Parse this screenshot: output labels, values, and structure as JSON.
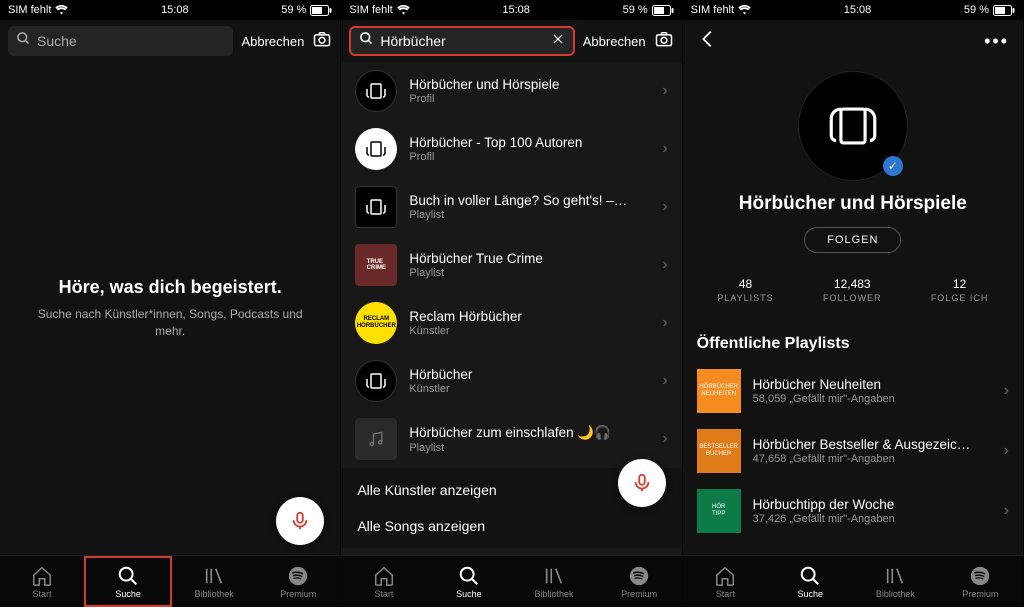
{
  "status": {
    "carrier": "SIM fehlt",
    "time": "15:08",
    "battery": "59 %"
  },
  "screen1": {
    "search_placeholder": "Suche",
    "cancel": "Abbrechen",
    "empty_title": "Höre, was dich begeistert.",
    "empty_sub": "Suche nach Künstler*innen, Songs, Podcasts und mehr."
  },
  "screen2": {
    "search_value": "Hörbücher",
    "cancel": "Abbrechen",
    "results": [
      {
        "title": "Hörbücher und Hörspiele",
        "sub": "Profil"
      },
      {
        "title": "Hörbücher - Top 100 Autoren",
        "sub": "Profil"
      },
      {
        "title": "Buch in voller Länge? So geht's! –…",
        "sub": "Playlist"
      },
      {
        "title": "Hörbücher True Crime",
        "sub": "Playlist"
      },
      {
        "title": "Reclam Hörbücher",
        "sub": "Künstler"
      },
      {
        "title": "Hörbücher",
        "sub": "Künstler"
      },
      {
        "title": "Hörbücher zum einschlafen 🌙🎧",
        "sub": "Playlist"
      }
    ],
    "show_all_artists": "Alle Künstler anzeigen",
    "show_all_songs": "Alle Songs anzeigen"
  },
  "screen3": {
    "name": "Hörbücher und Hörspiele",
    "follow": "FOLGEN",
    "stats": [
      {
        "num": "48",
        "label": "PLAYLISTS"
      },
      {
        "num": "12,483",
        "label": "FOLLOWER"
      },
      {
        "num": "12",
        "label": "FOLGE ICH"
      }
    ],
    "section": "Öffentliche Playlists",
    "playlists": [
      {
        "title": "Hörbücher Neuheiten",
        "sub": "58,059 „Gefällt mir\"-Angaben"
      },
      {
        "title": "Hörbücher Bestseller & Ausgezeic…",
        "sub": "47,658 „Gefällt mir\"-Angaben"
      },
      {
        "title": "Hörbuchtipp der Woche",
        "sub": "37,426 „Gefällt mir\"-Angaben"
      }
    ]
  },
  "tabs": {
    "start": "Start",
    "suche": "Suche",
    "bibliothek": "Bibliothek",
    "premium": "Premium"
  }
}
